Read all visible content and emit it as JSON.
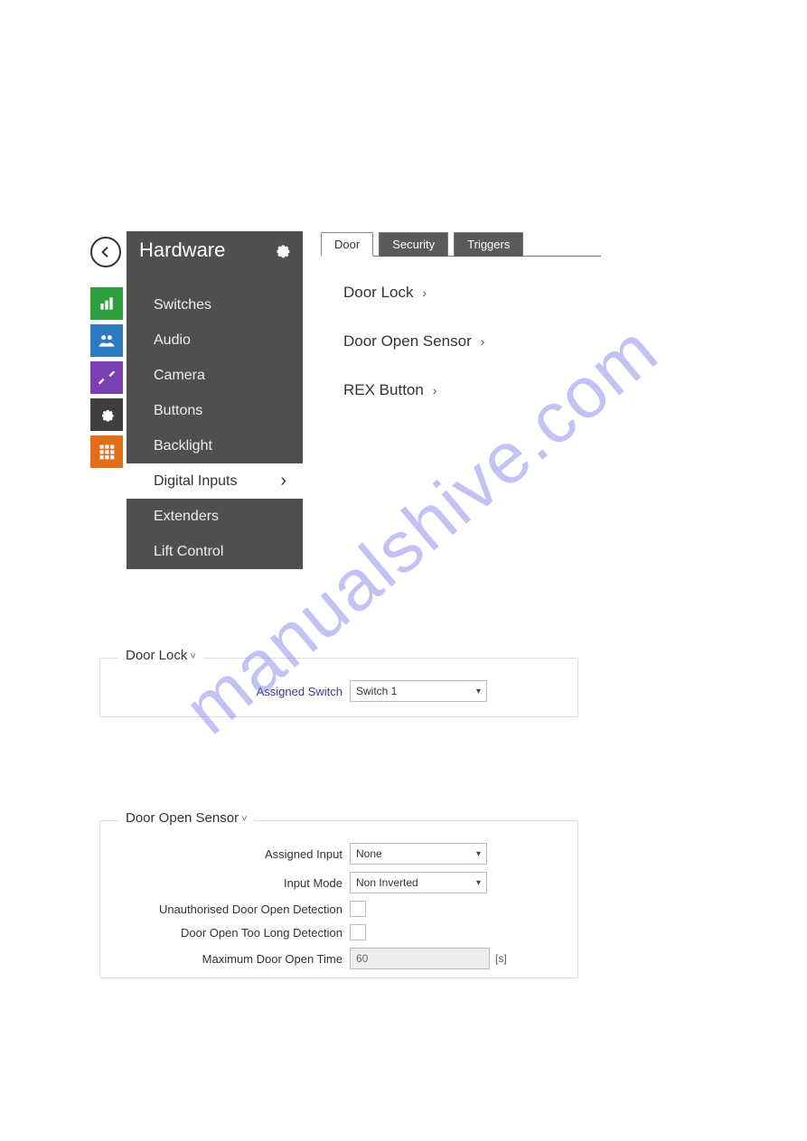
{
  "watermark": "manualshive.com",
  "sidebar": {
    "title": "Hardware",
    "items": [
      {
        "label": "Switches",
        "active": false
      },
      {
        "label": "Audio",
        "active": false
      },
      {
        "label": "Camera",
        "active": false
      },
      {
        "label": "Buttons",
        "active": false
      },
      {
        "label": "Backlight",
        "active": false
      },
      {
        "label": "Digital Inputs",
        "active": true
      },
      {
        "label": "Extenders",
        "active": false
      },
      {
        "label": "Lift Control",
        "active": false
      }
    ]
  },
  "rail_colors": [
    "#2e9f3f",
    "#2c7bbf",
    "#7a3fb1",
    "#3f3f3f",
    "#e36e1a"
  ],
  "tabs": [
    {
      "label": "Door",
      "active": true
    },
    {
      "label": "Security",
      "active": false
    },
    {
      "label": "Triggers",
      "active": false
    }
  ],
  "links": [
    "Door Lock",
    "Door Open Sensor",
    "REX Button"
  ],
  "panel1": {
    "legend": "Door Lock",
    "row1": {
      "label": "Assigned Switch",
      "value": "Switch 1"
    }
  },
  "panel2": {
    "legend": "Door Open Sensor",
    "rows": {
      "assigned_input": {
        "label": "Assigned Input",
        "value": "None"
      },
      "input_mode": {
        "label": "Input Mode",
        "value": "Non Inverted"
      },
      "unauth": {
        "label": "Unauthorised Door Open Detection"
      },
      "toolong": {
        "label": "Door Open Too Long Detection"
      },
      "maxtime": {
        "label": "Maximum Door Open Time",
        "value": "60",
        "unit": "[s]"
      }
    }
  }
}
